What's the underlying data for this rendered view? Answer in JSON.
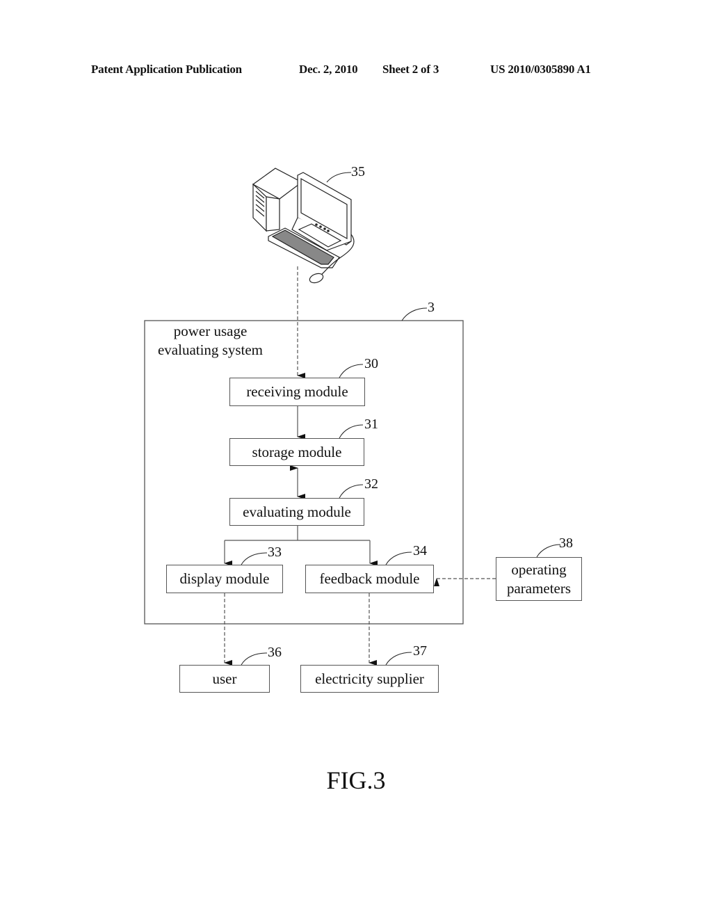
{
  "header": {
    "publication": "Patent Application Publication",
    "date": "Dec. 2, 2010",
    "sheet": "Sheet 2 of 3",
    "number": "US 2010/0305890 A1"
  },
  "figure": {
    "label": "FIG.3",
    "computer": {
      "icon": "desktop-computer-icon",
      "ref": "35"
    },
    "system": {
      "ref": "3",
      "label_line1": "power usage",
      "label_line2": "evaluating system"
    },
    "modules": {
      "receiving": {
        "label": "receiving module",
        "ref": "30"
      },
      "storage": {
        "label": "storage module",
        "ref": "31"
      },
      "evaluating": {
        "label": "evaluating module",
        "ref": "32"
      },
      "display": {
        "label": "display module",
        "ref": "33"
      },
      "feedback": {
        "label": "feedback module",
        "ref": "34"
      }
    },
    "externals": {
      "user": {
        "label": "user",
        "ref": "36"
      },
      "supplier": {
        "label": "electricity supplier",
        "ref": "37"
      },
      "parameters": {
        "label_line1": "operating",
        "label_line2": "parameters",
        "ref": "38"
      }
    }
  }
}
